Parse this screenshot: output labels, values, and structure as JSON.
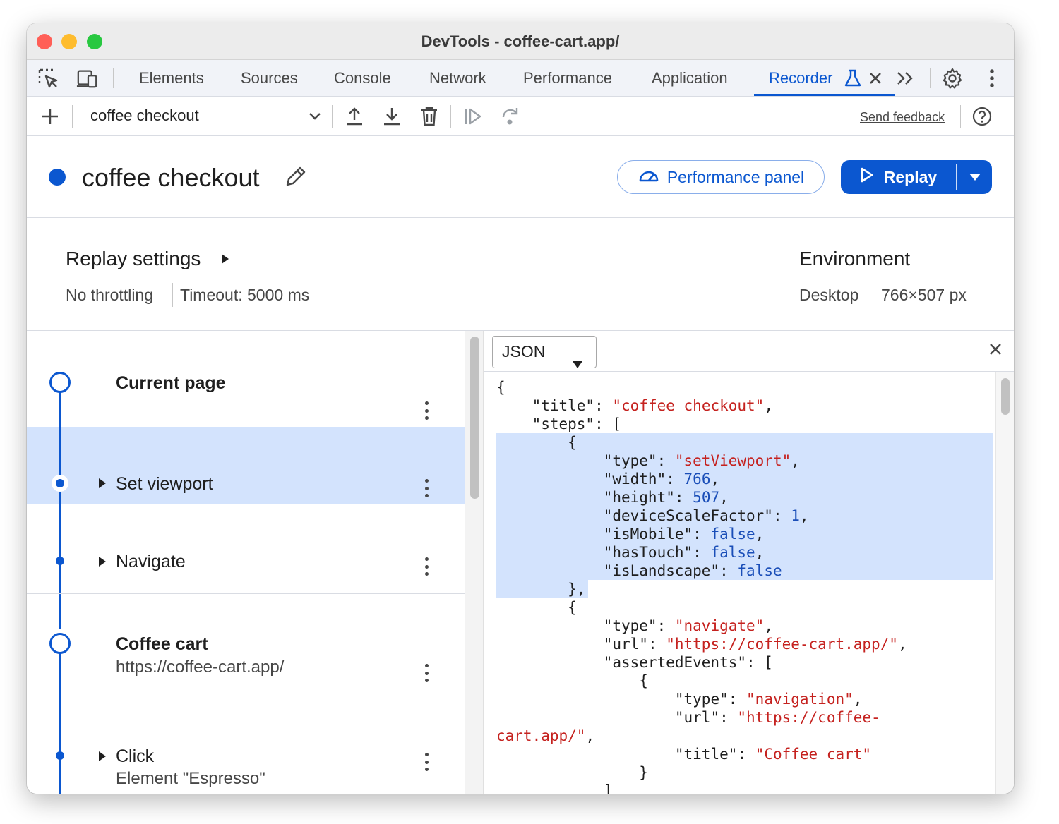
{
  "window": {
    "title": "DevTools - coffee-cart.app/"
  },
  "tabs": {
    "items": [
      "Elements",
      "Sources",
      "Console",
      "Network",
      "Performance",
      "Application",
      "Recorder"
    ],
    "active": "Recorder"
  },
  "toolbar": {
    "recording_select": "coffee checkout",
    "send_feedback": "Send feedback"
  },
  "header": {
    "recording_title": "coffee checkout",
    "performance_panel_label": "Performance panel",
    "replay_label": "Replay"
  },
  "replay_settings": {
    "title": "Replay settings",
    "throttling": "No throttling",
    "timeout": "Timeout: 5000 ms"
  },
  "environment": {
    "title": "Environment",
    "device": "Desktop",
    "viewport": "766×507 px"
  },
  "steps": [
    {
      "title": "Current page",
      "subtitle": ""
    },
    {
      "title": "Set viewport",
      "subtitle": ""
    },
    {
      "title": "Navigate",
      "subtitle": ""
    },
    {
      "title": "Coffee cart",
      "subtitle": "https://coffee-cart.app/"
    },
    {
      "title": "Click",
      "subtitle": "Element \"Espresso\""
    }
  ],
  "code_panel": {
    "format": "JSON",
    "lines": [
      [
        [
          "p",
          "{"
        ]
      ],
      [
        [
          "p",
          "    "
        ],
        [
          "k",
          "\"title\""
        ],
        [
          "p",
          ": "
        ],
        [
          "s",
          "\"coffee checkout\""
        ],
        [
          "p",
          ","
        ]
      ],
      [
        [
          "p",
          "    "
        ],
        [
          "k",
          "\"steps\""
        ],
        [
          "p",
          ": ["
        ]
      ],
      [
        [
          "p",
          "        {"
        ]
      ],
      [
        [
          "p",
          "            "
        ],
        [
          "k",
          "\"type\""
        ],
        [
          "p",
          ": "
        ],
        [
          "s",
          "\"setViewport\""
        ],
        [
          "p",
          ","
        ]
      ],
      [
        [
          "p",
          "            "
        ],
        [
          "k",
          "\"width\""
        ],
        [
          "p",
          ": "
        ],
        [
          "n",
          "766"
        ],
        [
          "p",
          ","
        ]
      ],
      [
        [
          "p",
          "            "
        ],
        [
          "k",
          "\"height\""
        ],
        [
          "p",
          ": "
        ],
        [
          "n",
          "507"
        ],
        [
          "p",
          ","
        ]
      ],
      [
        [
          "p",
          "            "
        ],
        [
          "k",
          "\"deviceScaleFactor\""
        ],
        [
          "p",
          ": "
        ],
        [
          "n",
          "1"
        ],
        [
          "p",
          ","
        ]
      ],
      [
        [
          "p",
          "            "
        ],
        [
          "k",
          "\"isMobile\""
        ],
        [
          "p",
          ": "
        ],
        [
          "b",
          "false"
        ],
        [
          "p",
          ","
        ]
      ],
      [
        [
          "p",
          "            "
        ],
        [
          "k",
          "\"hasTouch\""
        ],
        [
          "p",
          ": "
        ],
        [
          "b",
          "false"
        ],
        [
          "p",
          ","
        ]
      ],
      [
        [
          "p",
          "            "
        ],
        [
          "k",
          "\"isLandscape\""
        ],
        [
          "p",
          ": "
        ],
        [
          "b",
          "false"
        ]
      ],
      [
        [
          "p",
          "        },"
        ]
      ],
      [
        [
          "p",
          "        {"
        ]
      ],
      [
        [
          "p",
          "            "
        ],
        [
          "k",
          "\"type\""
        ],
        [
          "p",
          ": "
        ],
        [
          "s",
          "\"navigate\""
        ],
        [
          "p",
          ","
        ]
      ],
      [
        [
          "p",
          "            "
        ],
        [
          "k",
          "\"url\""
        ],
        [
          "p",
          ": "
        ],
        [
          "s",
          "\"https://coffee-cart.app/\""
        ],
        [
          "p",
          ","
        ]
      ],
      [
        [
          "p",
          "            "
        ],
        [
          "k",
          "\"assertedEvents\""
        ],
        [
          "p",
          ": ["
        ]
      ],
      [
        [
          "p",
          "                {"
        ]
      ],
      [
        [
          "p",
          "                    "
        ],
        [
          "k",
          "\"type\""
        ],
        [
          "p",
          ": "
        ],
        [
          "s",
          "\"navigation\""
        ],
        [
          "p",
          ","
        ]
      ],
      [
        [
          "p",
          "                    "
        ],
        [
          "k",
          "\"url\""
        ],
        [
          "p",
          ": "
        ],
        [
          "s",
          "\"https://coffee-"
        ]
      ],
      [
        [
          "s",
          "cart.app/\""
        ],
        [
          "p",
          ","
        ]
      ],
      [
        [
          "p",
          "                    "
        ],
        [
          "k",
          "\"title\""
        ],
        [
          "p",
          ": "
        ],
        [
          "s",
          "\"Coffee cart\""
        ]
      ],
      [
        [
          "p",
          "                }"
        ]
      ],
      [
        [
          "p",
          "            ]"
        ]
      ]
    ]
  }
}
